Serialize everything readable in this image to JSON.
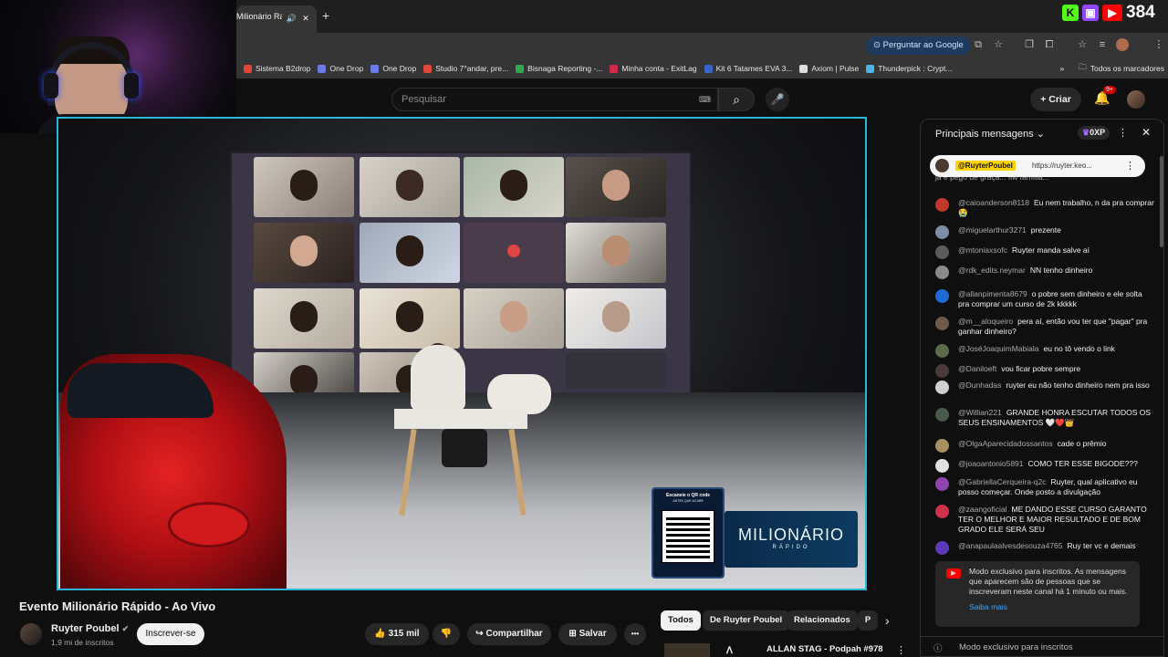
{
  "stream_overlay": {
    "viewer_count": "384",
    "icons": [
      "kick-icon",
      "twitch-icon",
      "youtube-icon"
    ]
  },
  "browser": {
    "tab_title": "Milionário Rá",
    "new_tab": "+",
    "ask_google": "Perguntar ao Google",
    "bookmarks": [
      {
        "label": "Sistema B2drop",
        "color": "#e0463a"
      },
      {
        "label": "One Drop",
        "color": "#6b7ce8"
      },
      {
        "label": "One Drop",
        "color": "#6b7ce8"
      },
      {
        "label": "Studio 7°andar, pre...",
        "color": "#e0463a"
      },
      {
        "label": "Bisnaga Reporting -...",
        "color": "#2fa84f"
      },
      {
        "label": "Minha conta - ExitLag",
        "color": "#d02a4a"
      },
      {
        "label": "Kit 6 Tatames EVA 3...",
        "color": "#3a64c8"
      },
      {
        "label": "Axiom | Pulse",
        "color": "#dddddd"
      },
      {
        "label": "Thunderpick : Crypt...",
        "color": "#4ab3e8"
      }
    ],
    "more_bookmarks": "»",
    "all_bookmarks": "Todos os marcadores"
  },
  "youtube": {
    "search_placeholder": "Pesquisar",
    "create_label": "Criar",
    "notifications": "9+"
  },
  "video": {
    "title": "Evento Milionário Rápido - Ao Vivo",
    "qr_caption": "Escaneie o QR code",
    "qr_subcaption": "ANTES QUE ACABE",
    "logo_big": "MILIONÁRIO",
    "logo_small": "RÁPIDO"
  },
  "channel": {
    "name": "Ruyter Poubel",
    "subscribers": "1,9 mi de inscritos",
    "subscribe_label": "Inscrever-se"
  },
  "actions": {
    "likes": "315 mil",
    "share": "Compartilhar",
    "save": "Salvar",
    "more": "•••"
  },
  "chips": [
    "Todos",
    "De Ruyter Poubel",
    "Relacionados",
    "P"
  ],
  "next_video": "ALLAN STAG - Podpah #978",
  "chat": {
    "header": "Principais mensagens",
    "xp": "0XP",
    "pinned_author": "@RuyterPoubel",
    "pinned_link": "https://ruyter.keo...",
    "partial_top": "já e pego de graça... fiw família...",
    "messages": [
      {
        "author": "@caioanderson8118",
        "text": "Eu nem trabalho, n da pra comprar 😭",
        "color": "#c0392b"
      },
      {
        "author": "@miguelarthur3271",
        "text": "prezente",
        "color": "#7c8da8"
      },
      {
        "author": "@mtoniaxsofc",
        "text": "Ruyter manda salve aí",
        "color": "#5b5b5b"
      },
      {
        "author": "@rdk_edits.neymar",
        "text": "NN tenho dinheiro",
        "color": "#8a8a8a"
      },
      {
        "author": "@allanpimenta8679",
        "text": "o pobre sem dinheiro e ele solta pra comprar um curso de 2k kkkkk",
        "color": "#1e6bd6"
      },
      {
        "author": "@m__aloqueiro",
        "text": "pera aí, então vou ter que \"pagar\" pra ganhar dinheiro?",
        "color": "#6e5a4a"
      },
      {
        "author": "@JoséJoaquimMabiala",
        "text": "eu no tô vendo o link",
        "color": "#5a6a4a"
      },
      {
        "author": "@Daniloeft",
        "text": "vou ficar pobre sempre",
        "color": "#4a3a3a"
      },
      {
        "author": "@Dunhadas",
        "text": "ruyter eu não tenho dinheiro nem pra isso",
        "color": "#d0d0d0"
      },
      {
        "author": "@Willian221",
        "text": "GRANDE HONRA ESCUTAR TODOS OS SEUS ENSINAMENTOS 🤍❤️👑",
        "color": "#4a5a4a"
      },
      {
        "author": "@OlgaAparecidadossantos",
        "text": "cade o prêmio",
        "color": "#a89060"
      },
      {
        "author": "@joaoantonio5891",
        "text": "COMO TER ESSE BIGODE???",
        "color": "#e0e0e0"
      },
      {
        "author": "@GabriellaCerqueira-q2c",
        "text": "Ruyter, qual aplicativo eu posso começar. Onde posto a divulgação",
        "color": "#8e44ad"
      },
      {
        "author": "@zaangoficial",
        "text": "ME DANDO ESSE CURSO GARANTO TER O MELHOR E MAIOR RESULTADO E DE BOM GRADO ELE SERÁ SEU",
        "color": "#d0314a"
      },
      {
        "author": "@anapaulaalvesdesouza4765",
        "text": "Ruy ter vc e demais",
        "color": "#5a3ab8"
      }
    ],
    "notice_text": "Modo exclusivo para inscritos. As mensagens que aparecem são de pessoas que se inscreveram neste canal há 1 minuto ou mais.",
    "notice_link": "Saiba mais",
    "footer": "Modo exclusivo para inscritos"
  }
}
